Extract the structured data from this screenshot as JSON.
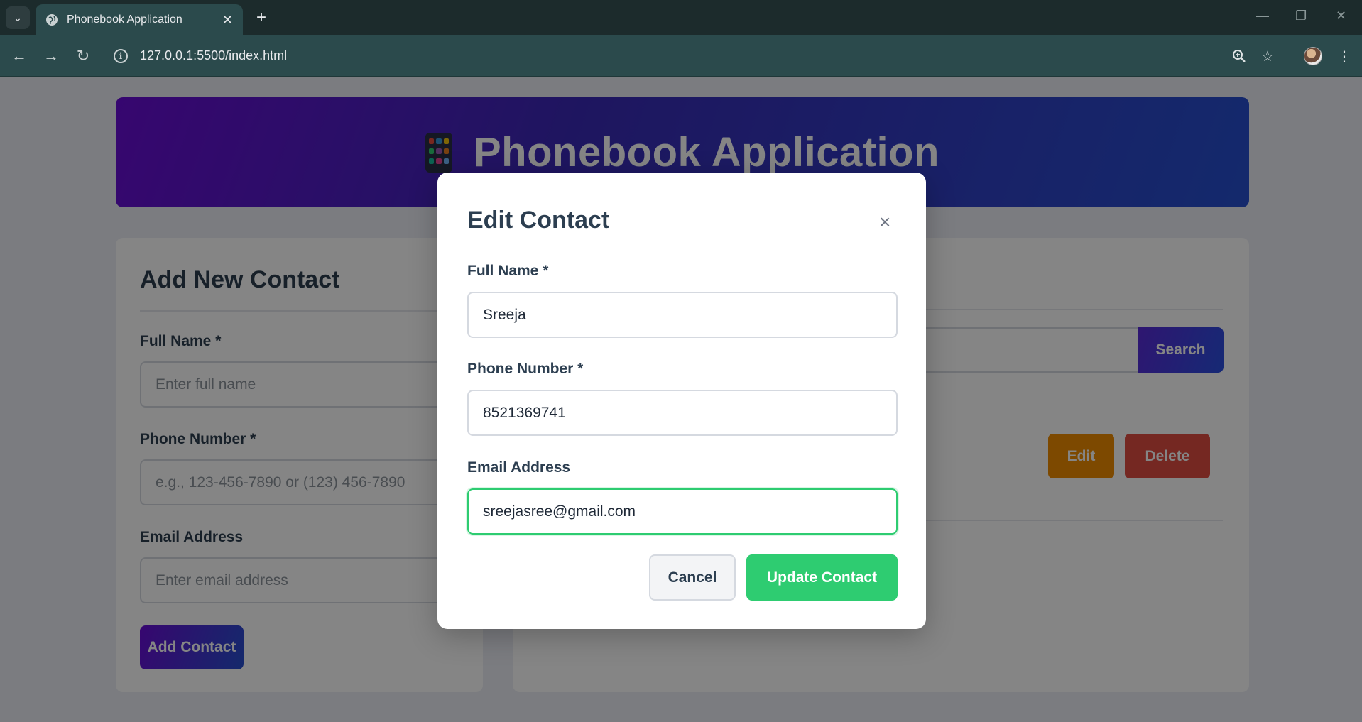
{
  "browser": {
    "tab_title": "Phonebook Application",
    "url": "127.0.0.1:5500/index.html"
  },
  "header": {
    "title": "Phonebook Application",
    "icon": "mobile-phone-icon"
  },
  "add_form": {
    "title": "Add New Contact",
    "name_label": "Full Name *",
    "name_placeholder": "Enter full name",
    "phone_label": "Phone Number *",
    "phone_placeholder": "e.g., 123-456-7890 or (123) 456-7890",
    "email_label": "Email Address",
    "email_placeholder": "Enter email address",
    "submit_label": "Add Contact"
  },
  "contacts_panel": {
    "search_label": "Search",
    "edit_label": "Edit",
    "delete_label": "Delete"
  },
  "modal": {
    "title": "Edit Contact",
    "close_symbol": "×",
    "name_label": "Full Name *",
    "name_value": "Sreeja",
    "phone_label": "Phone Number *",
    "phone_value": "8521369741",
    "email_label": "Email Address",
    "email_value": "sreejasree@gmail.com",
    "cancel_label": "Cancel",
    "update_label": "Update Contact"
  },
  "colors": {
    "accent_gradient_start": "#6a0dd6",
    "accent_gradient_end": "#2750d0",
    "success": "#2ecc71",
    "warning": "#f08c00",
    "danger": "#e04d41",
    "text_dark": "#2c3e50"
  }
}
